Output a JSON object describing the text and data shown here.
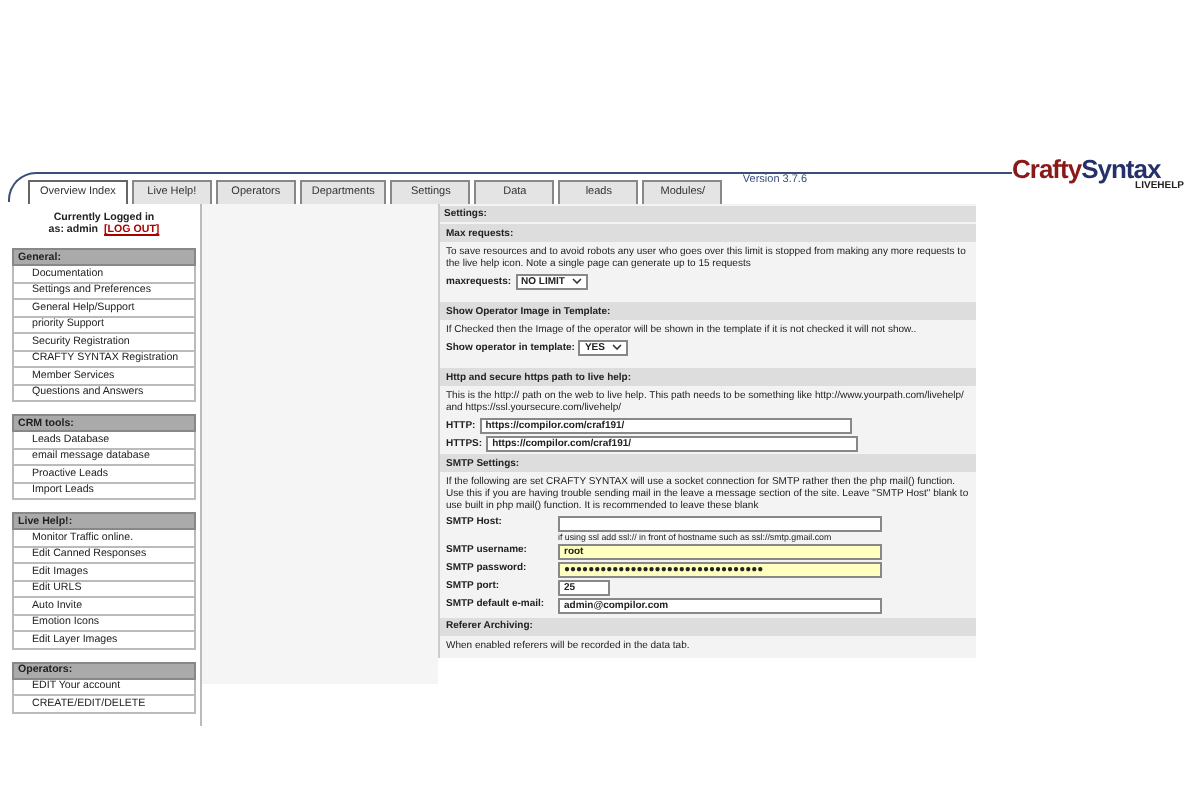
{
  "tabs": [
    {
      "label": "Overview Index",
      "selected": true
    },
    {
      "label": "Live Help!",
      "selected": false
    },
    {
      "label": "Operators",
      "selected": false
    },
    {
      "label": "Departments",
      "selected": false
    },
    {
      "label": "Settings",
      "selected": false
    },
    {
      "label": "Data",
      "selected": false
    },
    {
      "label": "leads",
      "selected": false
    },
    {
      "label": "Modules/",
      "selected": false
    }
  ],
  "version": "Version 3.7.6",
  "logo": {
    "first": "Crafty",
    "second": "Syntax",
    "sub": "LIVEHELP"
  },
  "login": {
    "line": "Currently Logged in",
    "user": "as: admin",
    "logout": "[LOG OUT]"
  },
  "sidebar": [
    {
      "title": "General:",
      "items": [
        "Documentation",
        "Settings and Preferences",
        "General Help/Support",
        "priority Support",
        "Security Registration",
        "CRAFTY SYNTAX Registration",
        "Member Services",
        "Questions and Answers"
      ]
    },
    {
      "title": "CRM tools:",
      "items": [
        "Leads Database",
        "email message database",
        "Proactive Leads",
        "Import Leads"
      ]
    },
    {
      "title": "Live Help!:",
      "items": [
        "Monitor Traffic online.",
        "Edit Canned Responses",
        "Edit Images",
        "Edit URLS",
        "Auto Invite",
        "Emotion Icons",
        "Edit Layer Images"
      ]
    },
    {
      "title": "Operators:",
      "items": [
        "EDIT Your account",
        "CREATE/EDIT/DELETE"
      ]
    }
  ],
  "settings": {
    "title": "Settings:",
    "blocks": [
      {
        "kind": "header",
        "text": "Max requests:"
      },
      {
        "kind": "text",
        "text": "To save resources and to avoid robots any user who goes over this limit is stopped from making any more requests to the live help icon. Note a single page can generate up to 15 requests"
      },
      {
        "kind": "select",
        "label": "maxrequests:",
        "value": "NO LIMIT"
      },
      {
        "kind": "header",
        "text": "Show Operator Image in Template:"
      },
      {
        "kind": "text",
        "text": "If Checked then the Image of the operator will be shown in the template if it is not checked it will not show.."
      },
      {
        "kind": "select",
        "label": "Show operator in template:",
        "value": "YES"
      },
      {
        "kind": "header",
        "text": "Http and secure https path to live help:"
      },
      {
        "kind": "text",
        "text": "This is the http:// path on the web to live help.  This path needs to be something like http://www.yourpath.com/livehelp/  and https://ssl.yoursecure.com/livehelp/"
      },
      {
        "kind": "inline",
        "label": "HTTP:",
        "value": "https://compilor.com/craf191/"
      },
      {
        "kind": "inline",
        "label": "HTTPS:",
        "value": "https://compilor.com/craf191/"
      },
      {
        "kind": "header",
        "text": "SMTP Settings:"
      },
      {
        "kind": "text",
        "text": "If the following are set CRAFTY SYNTAX will use a socket connection for SMTP rather then the php mail() function. Use this if you are having trouble sending mail in the leave a message section of the site. Leave \"SMTP Host\" blank to use built in php mail() function. It is recommended to leave these blank"
      },
      {
        "kind": "row",
        "label": "SMTP Host:",
        "note": "if using ssl add ssl:// in front of hostname such as ssl://smtp.gmail.com",
        "highlighted": false
      },
      {
        "kind": "row",
        "label": "SMTP username:",
        "value": "root",
        "highlighted": true
      },
      {
        "kind": "row",
        "label": "SMTP password:",
        "value": "●●●●●●●●●●●●●●●●●●●●●●●●●●●●●●●●●",
        "highlighted": true
      },
      {
        "kind": "row",
        "label": "SMTP port:",
        "value": "25",
        "highlighted": false
      },
      {
        "kind": "row",
        "label": "SMTP default e-mail:",
        "value": "admin@compilor.com",
        "highlighted": false
      },
      {
        "kind": "header",
        "text": "Referer Archiving:"
      },
      {
        "kind": "text",
        "text": "When enabled referers will be recorded in the data tab."
      }
    ]
  }
}
